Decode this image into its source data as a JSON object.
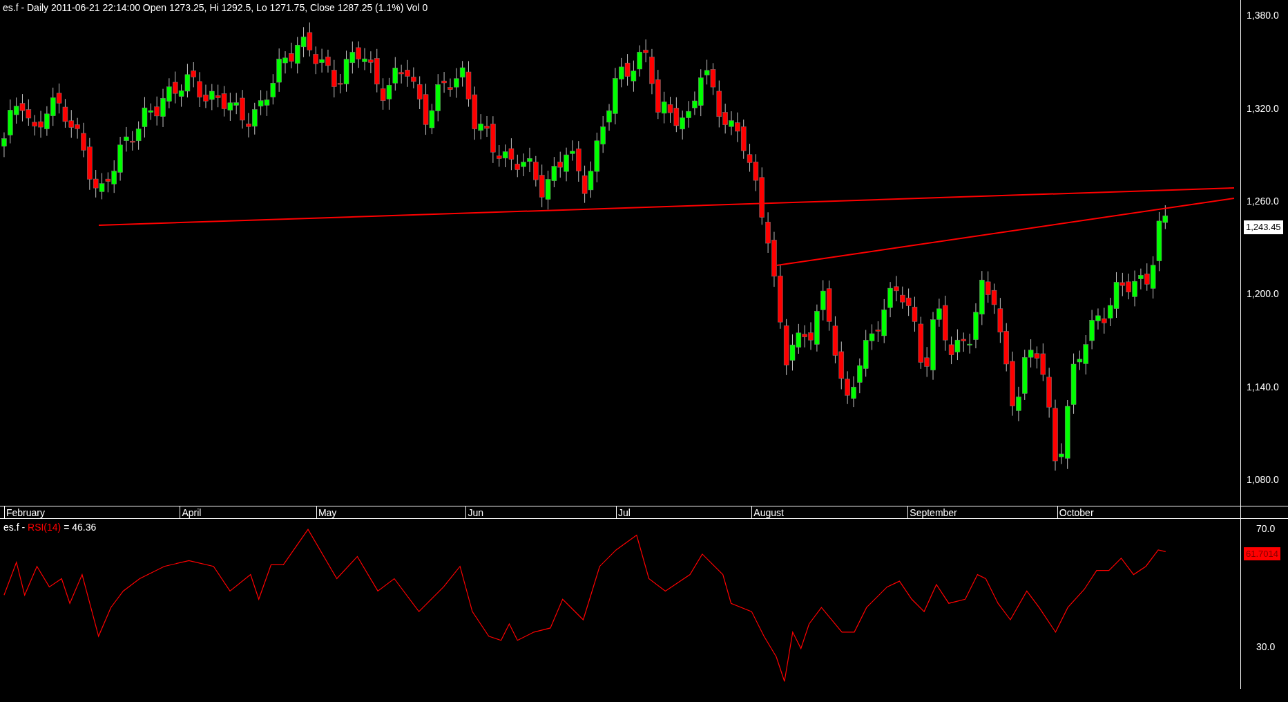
{
  "price_pane": {
    "title": "es.f - Daily 2011-06-21 22:14:00 Open 1273.25, Hi 1292.5, Lo 1271.75, Close 1287.25 (1.1%) Vol 0",
    "axis_labels": [
      "1,380.0",
      "1,320.0",
      "1,260.0",
      "1,200.0",
      "1,140.0",
      "1,080.0"
    ],
    "last_price": "1,243.45"
  },
  "date_axis": [
    "February",
    "April",
    "May",
    "Jun",
    "Jul",
    "August",
    "September",
    "October"
  ],
  "rsi_pane": {
    "symbol": "es.f - ",
    "indicator": "RSI(14)",
    "value": " = 46.36",
    "axis_labels": [
      "70.0",
      "30.0"
    ],
    "last_value": "61.7014"
  }
}
